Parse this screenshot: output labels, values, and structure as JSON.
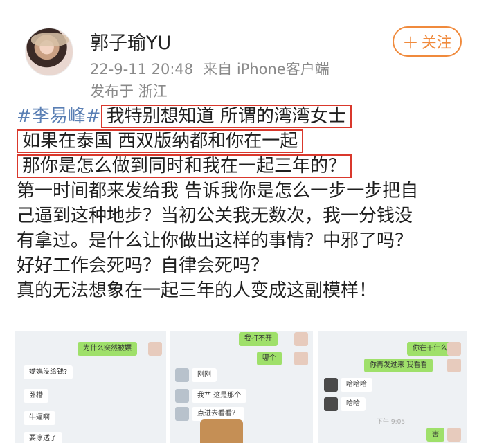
{
  "post": {
    "username": "郭子瑜YU",
    "datetime": "22-9-11 20:48",
    "source": "来自 iPhone客户端",
    "location": "发布于 浙江",
    "follow_label": "关注",
    "follow_plus": "+"
  },
  "content": {
    "hashtag": "#李易峰#",
    "line1_boxed": "我特别想知道 所谓的湾湾女士",
    "line2_boxed": "如果在泰国 西双版纳都和你在一起",
    "line3_boxed": "那你是怎么做到同时和我在一起三年的？",
    "line4": "第一时间都来发给我 告诉我你是怎么一步一步把自",
    "line5": "己逼到这种地步？当初公关我无数次，我一分钱没",
    "line6": "有拿过。是什么让你做出这样的事情？中邪了吗？",
    "line7": "好好工作会死吗？自律会死吗？",
    "line8": "真的无法想象在一起三年的人变成这副模样！"
  },
  "screenshots": {
    "s1": [
      "为什么突然被嫖",
      "嫖娼没给钱?",
      "卧槽",
      "牛逼啊",
      "要凉透了"
    ],
    "s2": [
      "我打不开",
      "哪个",
      "刚刚",
      "我艹 这是那个",
      "点进去看看？"
    ],
    "s3": [
      "你在干什么",
      "你再发过来 我看看",
      "哈哈哈",
      "哈哈",
      "害"
    ],
    "s3_time": "下午 9:05"
  },
  "colors": {
    "accent": "#f08a3c",
    "hashtag": "#5a7fb4",
    "highlight_box": "#d9382c",
    "meta_text": "#8a8a8a"
  }
}
